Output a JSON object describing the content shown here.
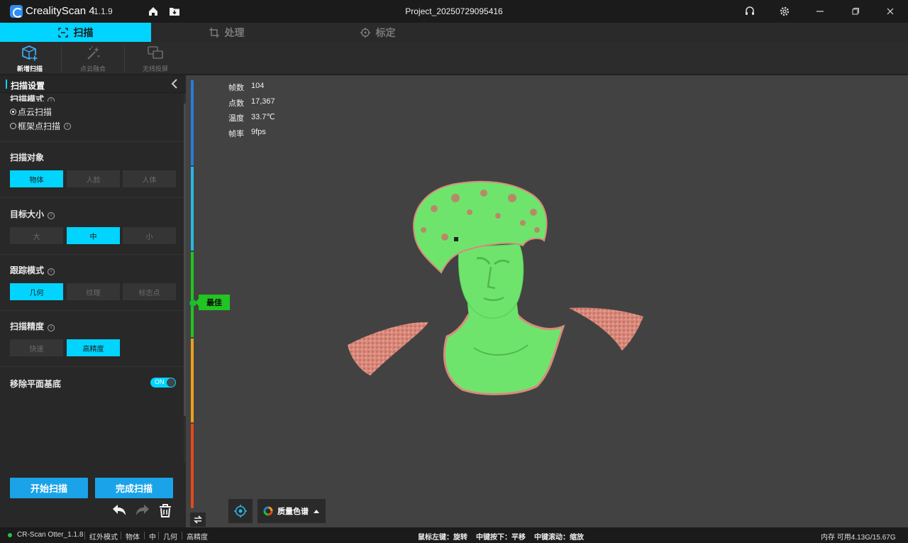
{
  "titlebar": {
    "app_name": "CrealityScan 4",
    "app_version": "1.1.9",
    "project_title": "Project_20250729095416"
  },
  "tabs": [
    {
      "label": "扫描",
      "icon": "scan-frame-icon",
      "active": true
    },
    {
      "label": "处理",
      "icon": "crop-icon",
      "active": false
    },
    {
      "label": "标定",
      "icon": "crosshair-icon",
      "active": false
    }
  ],
  "tools": [
    {
      "label": "新增扫描",
      "icon": "cube-add-icon",
      "active": true
    },
    {
      "label": "点云融合",
      "icon": "magic-wand-icon",
      "active": false
    },
    {
      "label": "无线投屏",
      "icon": "screen-cast-icon",
      "active": false
    }
  ],
  "panel": {
    "title": "扫描设置",
    "scan_mode": {
      "title": "扫描模式",
      "options": [
        {
          "label": "点云扫描",
          "selected": true
        },
        {
          "label": "框架点扫描",
          "selected": false
        }
      ]
    },
    "scan_target": {
      "title": "扫描对象",
      "options": [
        "物体",
        "人脸",
        "人体"
      ],
      "selected": 0
    },
    "target_size": {
      "title": "目标大小",
      "options": [
        "大",
        "中",
        "小"
      ],
      "selected": 1
    },
    "tracking_mode": {
      "title": "跟踪模式",
      "options": [
        "几何",
        "纹理",
        "标志点"
      ],
      "selected": 0
    },
    "scan_precision": {
      "title": "扫描精度",
      "options": [
        "快速",
        "高精度"
      ],
      "selected": 1
    },
    "remove_base": {
      "title": "移除平面基底",
      "toggle_label": "ON",
      "on": true
    },
    "start_button": "开始扫描",
    "finish_button": "完成扫描"
  },
  "viewport": {
    "stats": [
      {
        "label": "帧数",
        "value": "104"
      },
      {
        "label": "点数",
        "value": "17,367"
      },
      {
        "label": "温度",
        "value": "33.7℃"
      },
      {
        "label": "帧率",
        "value": "9fps"
      }
    ],
    "quality_label": "最佳",
    "color_button_label": "质量色谱",
    "colors": {
      "good": "#6fe46c",
      "poor": "#d98a7c",
      "accent": "#00d4ff"
    }
  },
  "statusbar": {
    "device": "CR-Scan Otter_1.1.8",
    "items": [
      "红外模式",
      "物体",
      "中",
      "几何",
      "高精度"
    ],
    "hints": [
      "鼠标左键：旋转",
      "中键按下：平移",
      "中键滚动：缩放"
    ],
    "memory": "内存 可用4.13G/15.67G"
  }
}
